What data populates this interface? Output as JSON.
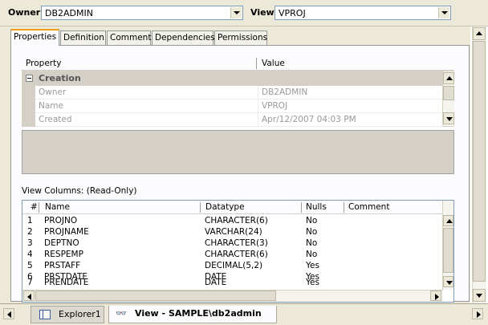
{
  "header": {
    "owner_label": "Owner",
    "owner_value": "DB2ADMIN",
    "view_label": "View",
    "view_value": "VPROJ"
  },
  "tabs": [
    {
      "label": "Properties",
      "active": true
    },
    {
      "label": "Definition",
      "active": false
    },
    {
      "label": "Comment",
      "active": false
    },
    {
      "label": "Dependencies",
      "active": false
    },
    {
      "label": "Permissions",
      "active": false
    }
  ],
  "property_grid": {
    "col_property": "Property",
    "col_value": "Value",
    "category": "Creation",
    "rows": [
      {
        "name": "Owner",
        "value": "DB2ADMIN"
      },
      {
        "name": "Name",
        "value": "VPROJ"
      },
      {
        "name": "Created",
        "value": "Apr/12/2007 04:03 PM"
      }
    ]
  },
  "view_columns": {
    "label": "View Columns: (Read-Only)",
    "headers": {
      "num": "#",
      "name": "Name",
      "datatype": "Datatype",
      "nulls": "Nulls",
      "comment": "Comment"
    },
    "rows": [
      {
        "num": "1",
        "name": "PROJNO",
        "datatype": "CHARACTER(6)",
        "nulls": "No"
      },
      {
        "num": "2",
        "name": "PROJNAME",
        "datatype": "VARCHAR(24)",
        "nulls": "No"
      },
      {
        "num": "3",
        "name": "DEPTNO",
        "datatype": "CHARACTER(3)",
        "nulls": "No"
      },
      {
        "num": "4",
        "name": "RESPEMP",
        "datatype": "CHARACTER(6)",
        "nulls": "No"
      },
      {
        "num": "5",
        "name": "PRSTAFF",
        "datatype": "DECIMAL(5,2)",
        "nulls": "Yes"
      },
      {
        "num": "6",
        "name": "PRSTDATE",
        "datatype": "DATE",
        "nulls": "Yes"
      },
      {
        "num": "7",
        "name": "PRENDATE",
        "datatype": "DATE",
        "nulls": "Yes"
      }
    ]
  },
  "bottom_tabs": [
    {
      "label": "Explorer1",
      "icon": "explorer-window-icon"
    },
    {
      "label": "View - SAMPLE\\db2admin",
      "icon": "view-glasses-icon"
    }
  ]
}
